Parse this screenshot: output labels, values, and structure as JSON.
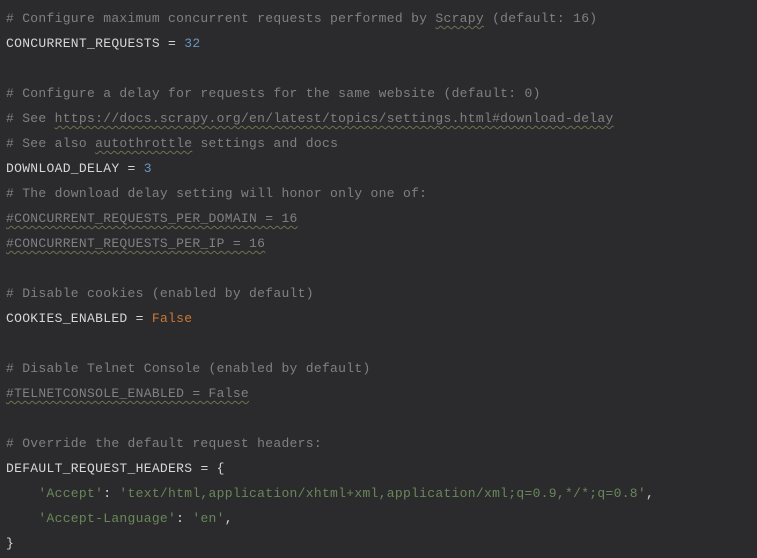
{
  "lines": {
    "l1_a": "# Configure maximum concurrent requests performed by ",
    "l1_b": "Scrapy",
    "l1_c": " (default: 16)",
    "l2_var": "CONCURRENT_REQUESTS",
    "l2_eq": " = ",
    "l2_val": "32",
    "l4": "# Configure a delay for requests for the same website (default: 0)",
    "l5_a": "# See ",
    "l5_b": "https://docs.scrapy.org/en/latest/topics/settings.html#download-delay",
    "l6_a": "# See also ",
    "l6_b": "autothrottle",
    "l6_c": " settings and docs",
    "l7_var": "DOWNLOAD_DELAY",
    "l7_eq": " = ",
    "l7_val": "3",
    "l8": "# The download delay setting will honor only one of:",
    "l9": "#CONCURRENT_REQUESTS_PER_DOMAIN = 16",
    "l10": "#CONCURRENT_REQUESTS_PER_IP = 16",
    "l12": "# Disable cookies (enabled by default)",
    "l13_var": "COOKIES_ENABLED",
    "l13_eq": " = ",
    "l13_val": "False",
    "l15": "# Disable Telnet Console (enabled by default)",
    "l16": "#TELNETCONSOLE_ENABLED = False",
    "l18": "# Override the default request headers:",
    "l19_var": "DEFAULT_REQUEST_HEADERS",
    "l19_eq": " = ",
    "l19_brace": "{",
    "l20_pad": "    ",
    "l20_k": "'Accept'",
    "l20_colon": ": ",
    "l20_v": "'text/html,application/xhtml+xml,application/xml;q=0.9,*/*;q=0.8'",
    "l20_comma": ",",
    "l21_pad": "    ",
    "l21_k": "'Accept-Language'",
    "l21_colon": ": ",
    "l21_v": "'en'",
    "l21_comma": ",",
    "l22": "}"
  }
}
